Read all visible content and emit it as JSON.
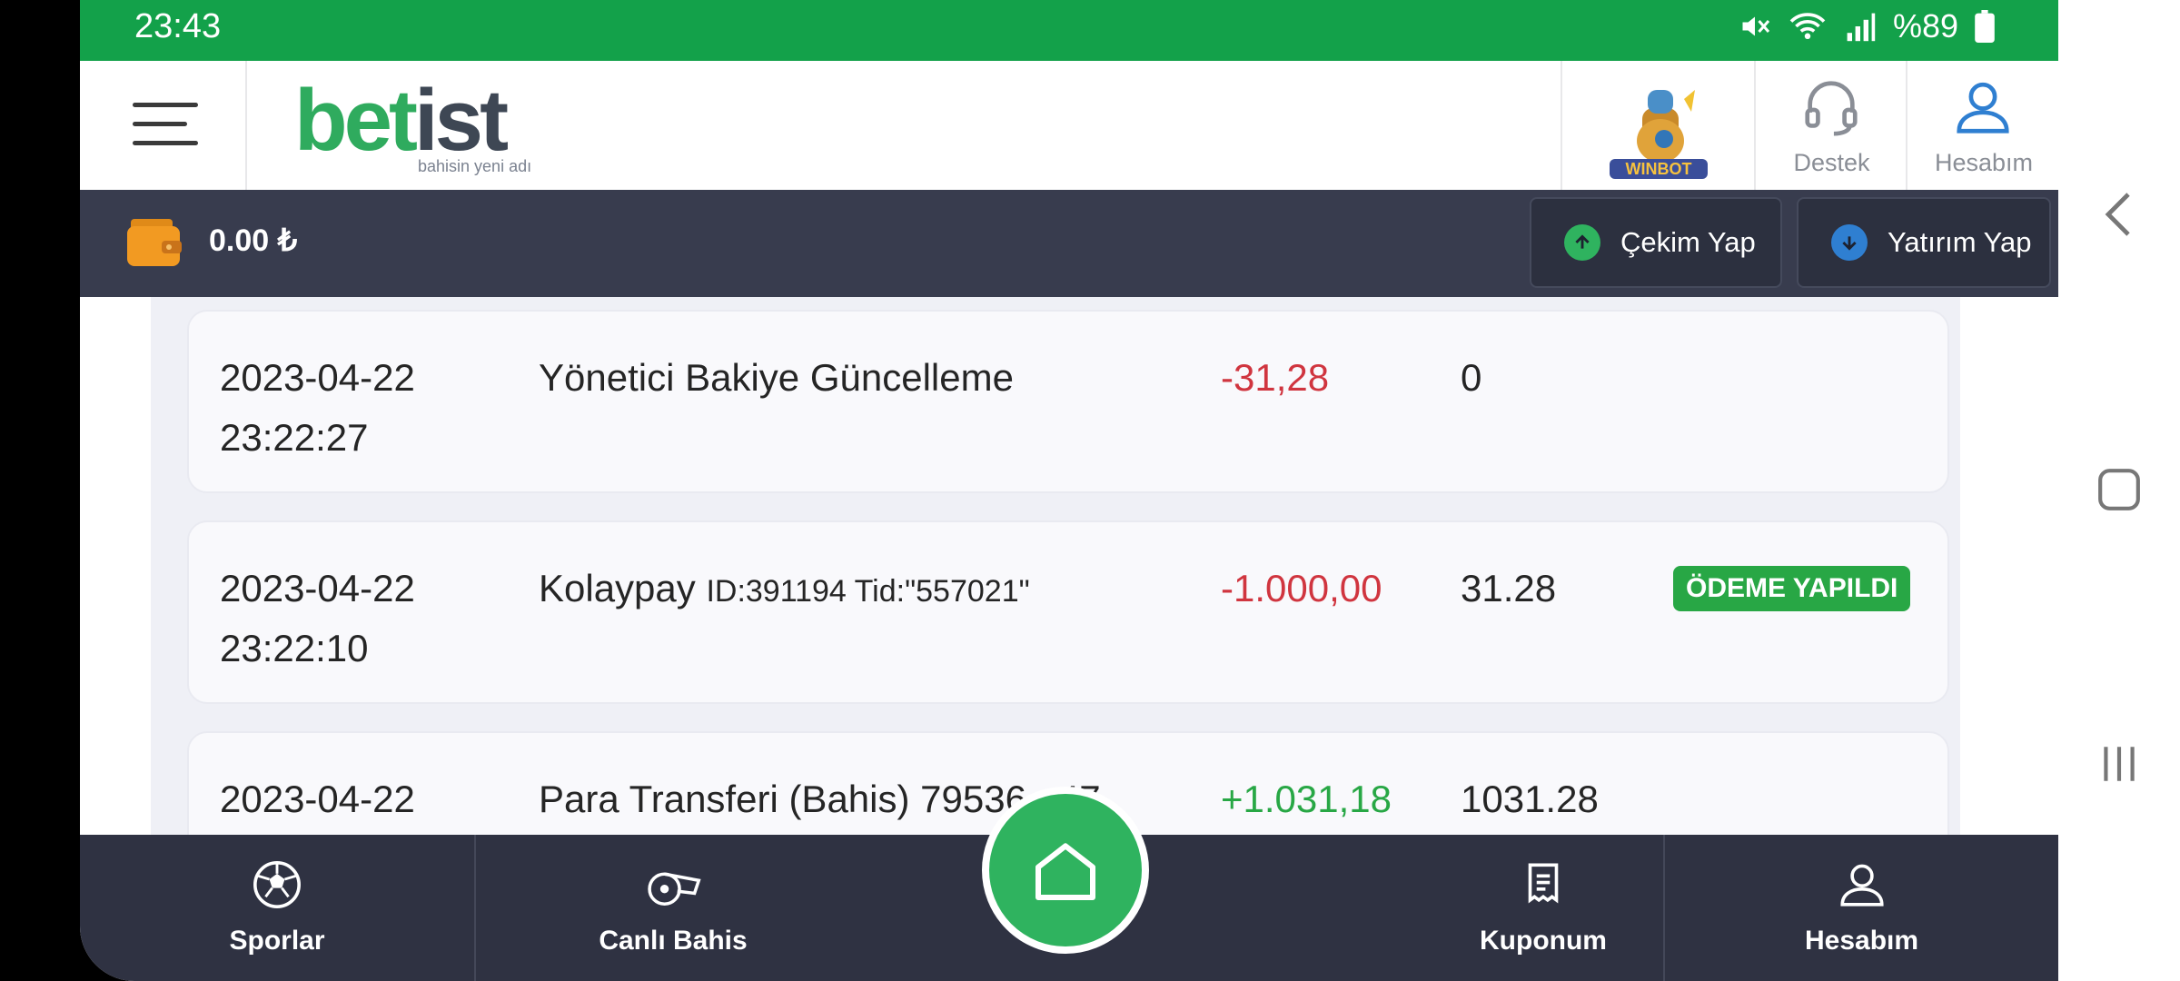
{
  "status_bar": {
    "time": "23:43",
    "battery": "%89"
  },
  "header": {
    "logo": {
      "bet": "bet",
      "ist": "ist",
      "slogan": "bahisin yeni adı"
    },
    "mascot_label": "WINBOT",
    "support_label": "Destek",
    "account_label": "Hesabım"
  },
  "wallet": {
    "balance": "0.00 ₺"
  },
  "actions": {
    "withdraw_label": "Çekim Yap",
    "deposit_label": "Yatırım Yap"
  },
  "transactions": [
    {
      "date": "2023-04-22",
      "time": "23:22:27",
      "desc": "Yönetici Bakiye Güncelleme",
      "ref": "",
      "amount": "-31,28",
      "balance": "0",
      "status": ""
    },
    {
      "date": "2023-04-22",
      "time": "23:22:10",
      "desc": "Kolaypay",
      "ref": "ID:391194 Tid:\"557021\"",
      "amount": "-1.000,00",
      "balance": "31.28",
      "status": "ÖDEME YAPILDI"
    },
    {
      "date": "2023-04-22",
      "time": "",
      "desc": "Para Transferi (Bahis) 79536...47",
      "ref": "",
      "amount": "+1.031,18",
      "balance": "1031.28",
      "status": ""
    }
  ],
  "bottom_nav": {
    "sports": "Sporlar",
    "live": "Canlı Bahis",
    "coupon": "Kuponum",
    "account": "Hesabım"
  },
  "colors": {
    "brand_green": "#2fab5e",
    "status_green": "#13a14a",
    "negative": "#d0353f",
    "positive": "#28a745",
    "dark_bar": "#383c4e"
  }
}
